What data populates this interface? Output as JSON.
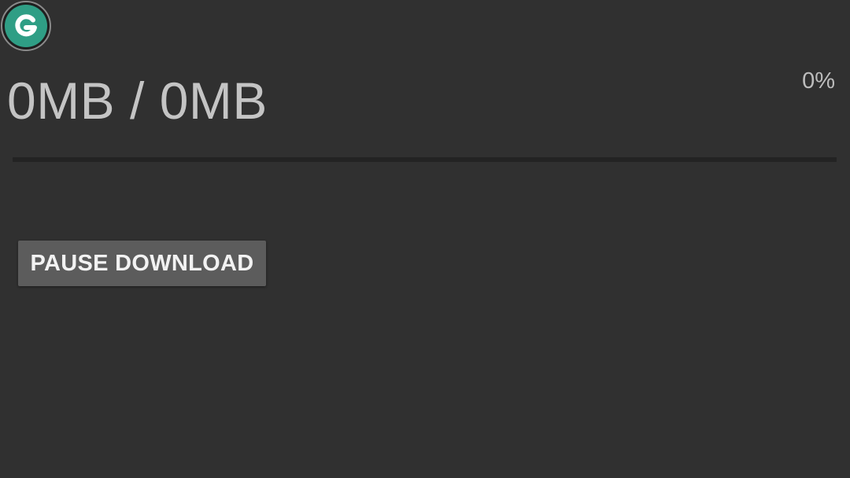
{
  "app": {
    "logo_icon": "g-logo-icon",
    "brand_color": "#2f9e85"
  },
  "download": {
    "size_text": "0MB / 0MB",
    "percent_text": "0%",
    "progress": 0,
    "pause_label": "PAUSE DOWNLOAD"
  }
}
